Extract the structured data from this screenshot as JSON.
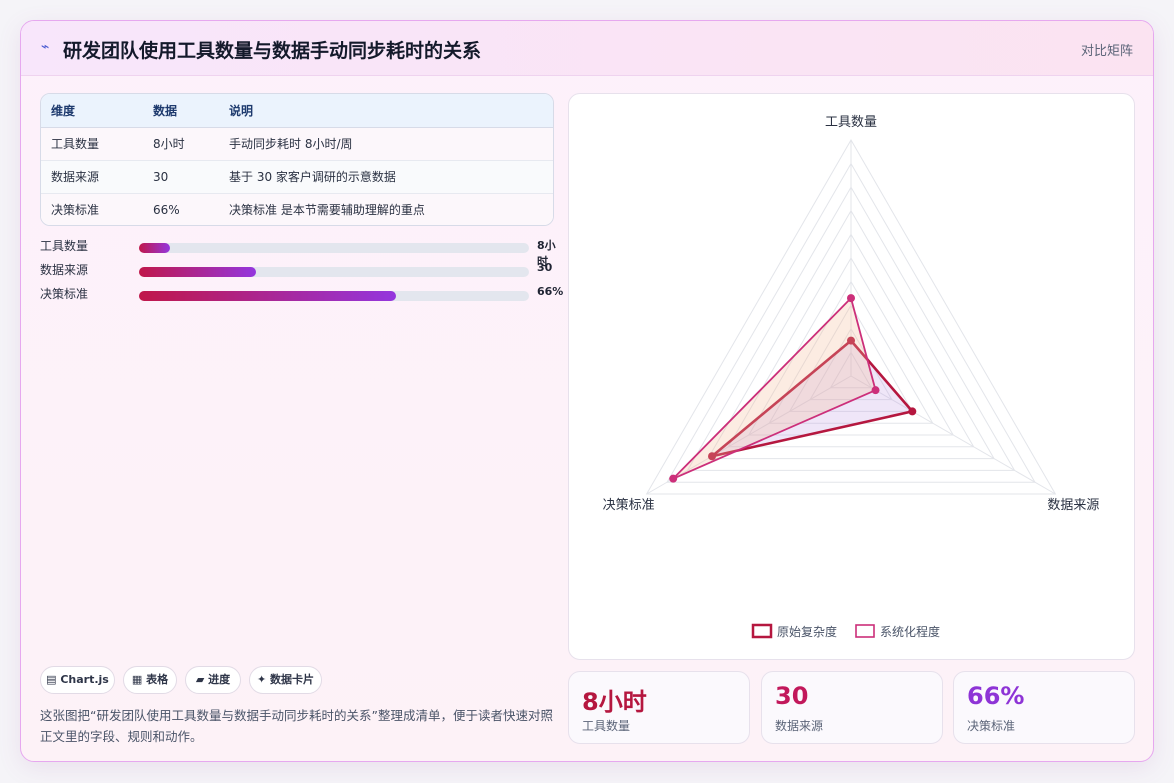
{
  "header": {
    "icon": "chart-line-icon",
    "title": "研发团队使用工具数量与数据手动同步耗时的关系",
    "tag": "对比矩阵"
  },
  "table": {
    "headers": [
      "维度",
      "数据",
      "说明"
    ],
    "rows": [
      [
        "工具数量",
        "8小时",
        "手动同步耗时 8小时/周"
      ],
      [
        "数据来源",
        "30",
        "基于 30 家客户调研的示意数据"
      ],
      [
        "决策标准",
        "66%",
        "决策标准 是本节需要辅助理解的重点"
      ]
    ]
  },
  "progress": [
    {
      "label": "工具数量",
      "value": "8小时",
      "fraction": 0.08
    },
    {
      "label": "数据来源",
      "value": "30",
      "fraction": 0.3
    },
    {
      "label": "决策标准",
      "value": "66%",
      "fraction": 0.66
    }
  ],
  "chips": [
    "▤ Chart.js",
    "▦ 表格",
    "▰ 进度",
    "✦ 数据卡片"
  ],
  "description": "这张图把“研发团队使用工具数量与数据手动同步耗时的关系”整理成清单，便于读者快速对照正文里的字段、规则和动作。",
  "stats": [
    {
      "value": "8小时",
      "label": "工具数量",
      "color": "#b5173f"
    },
    {
      "value": "30",
      "label": "数据来源",
      "color": "#c2185b"
    },
    {
      "value": "66%",
      "label": "决策标准",
      "color": "#8e34d6"
    }
  ],
  "chart_data": {
    "type": "radar",
    "categories": [
      "工具数量",
      "数据来源",
      "决策标准"
    ],
    "scale": {
      "min": 0,
      "max": 100,
      "steps": 10
    },
    "grid": true,
    "legend_position": "bottom",
    "series": [
      {
        "name": "原始复杂度",
        "values": [
          15,
          30,
          68
        ],
        "color": "#b5173f"
      },
      {
        "name": "系统化程度",
        "values": [
          33,
          12,
          87
        ],
        "color": "#cc2f7a"
      }
    ]
  }
}
